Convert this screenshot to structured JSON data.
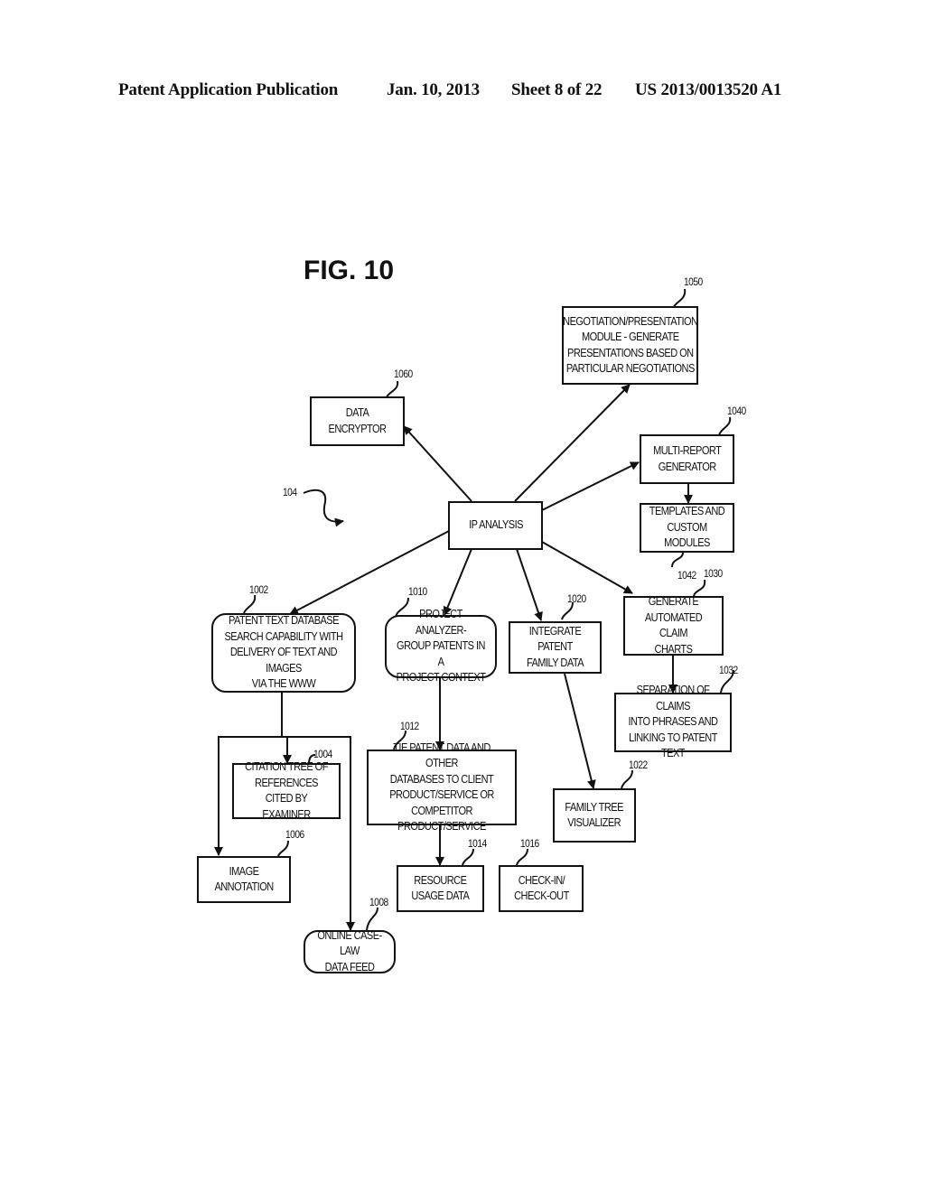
{
  "header": {
    "publication": "Patent Application Publication",
    "date": "Jan. 10, 2013",
    "sheet": "Sheet 8 of 22",
    "number": "US 2013/0013520 A1"
  },
  "figure": {
    "title": "FIG. 10",
    "system_ref": "104"
  },
  "nodes": {
    "ip_analysis": {
      "label": "IP ANALYSIS",
      "ref": ""
    },
    "n1050": {
      "label": "NEGOTIATION/PRESENTATION\nMODULE - GENERATE\nPRESENTATIONS BASED ON\nPARTICULAR NEGOTIATIONS",
      "ref": "1050"
    },
    "n1060": {
      "label": "DATA ENCRYPTOR",
      "ref": "1060"
    },
    "n1040": {
      "label": "MULTI-REPORT\nGENERATOR",
      "ref": "1040"
    },
    "n1042": {
      "label": "TEMPLATES AND\nCUSTOM MODULES",
      "ref": "1042"
    },
    "n1030": {
      "label": "GENERATE\nAUTOMATED CLAIM\nCHARTS",
      "ref": "1030"
    },
    "n1032": {
      "label": "SEPARATION OF CLAIMS\nINTO PHRASES AND\nLINKING TO PATENT TEXT",
      "ref": "1032"
    },
    "n1002": {
      "label": "PATENT TEXT DATABASE\nSEARCH CAPABILITY WITH\nDELIVERY OF TEXT AND IMAGES\nVIA THE WWW",
      "ref": "1002"
    },
    "n1010": {
      "label": "PROJECT ANALYZER-\nGROUP PATENTS IN A\nPROJECT CONTEXT",
      "ref": "1010"
    },
    "n1020": {
      "label": "INTEGRATE PATENT\nFAMILY DATA",
      "ref": "1020"
    },
    "n1004": {
      "label": "CITATION TREE OF\nREFERENCES CITED BY\nEXAMINER",
      "ref": "1004"
    },
    "n1012": {
      "label": "TIE PATENT DATA AND OTHER\nDATABASES TO CLIENT\nPRODUCT/SERVICE OR\nCOMPETITOR PRODUCT/SERVICE",
      "ref": "1012"
    },
    "n1022": {
      "label": "FAMILY TREE\nVISUALIZER",
      "ref": "1022"
    },
    "n1006": {
      "label": "IMAGE\nANNOTATION",
      "ref": "1006"
    },
    "n1014": {
      "label": "RESOURCE\nUSAGE DATA",
      "ref": "1014"
    },
    "n1016": {
      "label": "CHECK-IN/\nCHECK-OUT",
      "ref": "1016"
    },
    "n1008": {
      "label": "ONLINE CASE-LAW\nDATA FEED",
      "ref": "1008"
    }
  },
  "edges": [
    {
      "from": "ip_analysis",
      "to": "n1050"
    },
    {
      "from": "ip_analysis",
      "to": "n1060"
    },
    {
      "from": "ip_analysis",
      "to": "n1040"
    },
    {
      "from": "n1040",
      "to": "n1042"
    },
    {
      "from": "ip_analysis",
      "to": "n1030"
    },
    {
      "from": "n1030",
      "to": "n1032"
    },
    {
      "from": "ip_analysis",
      "to": "n1002"
    },
    {
      "from": "ip_analysis",
      "to": "n1010"
    },
    {
      "from": "ip_analysis",
      "to": "n1020"
    },
    {
      "from": "n1002",
      "to": "n1004"
    },
    {
      "from": "n1002",
      "to": "n1006"
    },
    {
      "from": "n1002",
      "to": "n1008"
    },
    {
      "from": "n1010",
      "to": "n1012"
    },
    {
      "from": "n1012",
      "to": "n1014"
    },
    {
      "from": "n1020",
      "to": "n1022"
    }
  ]
}
